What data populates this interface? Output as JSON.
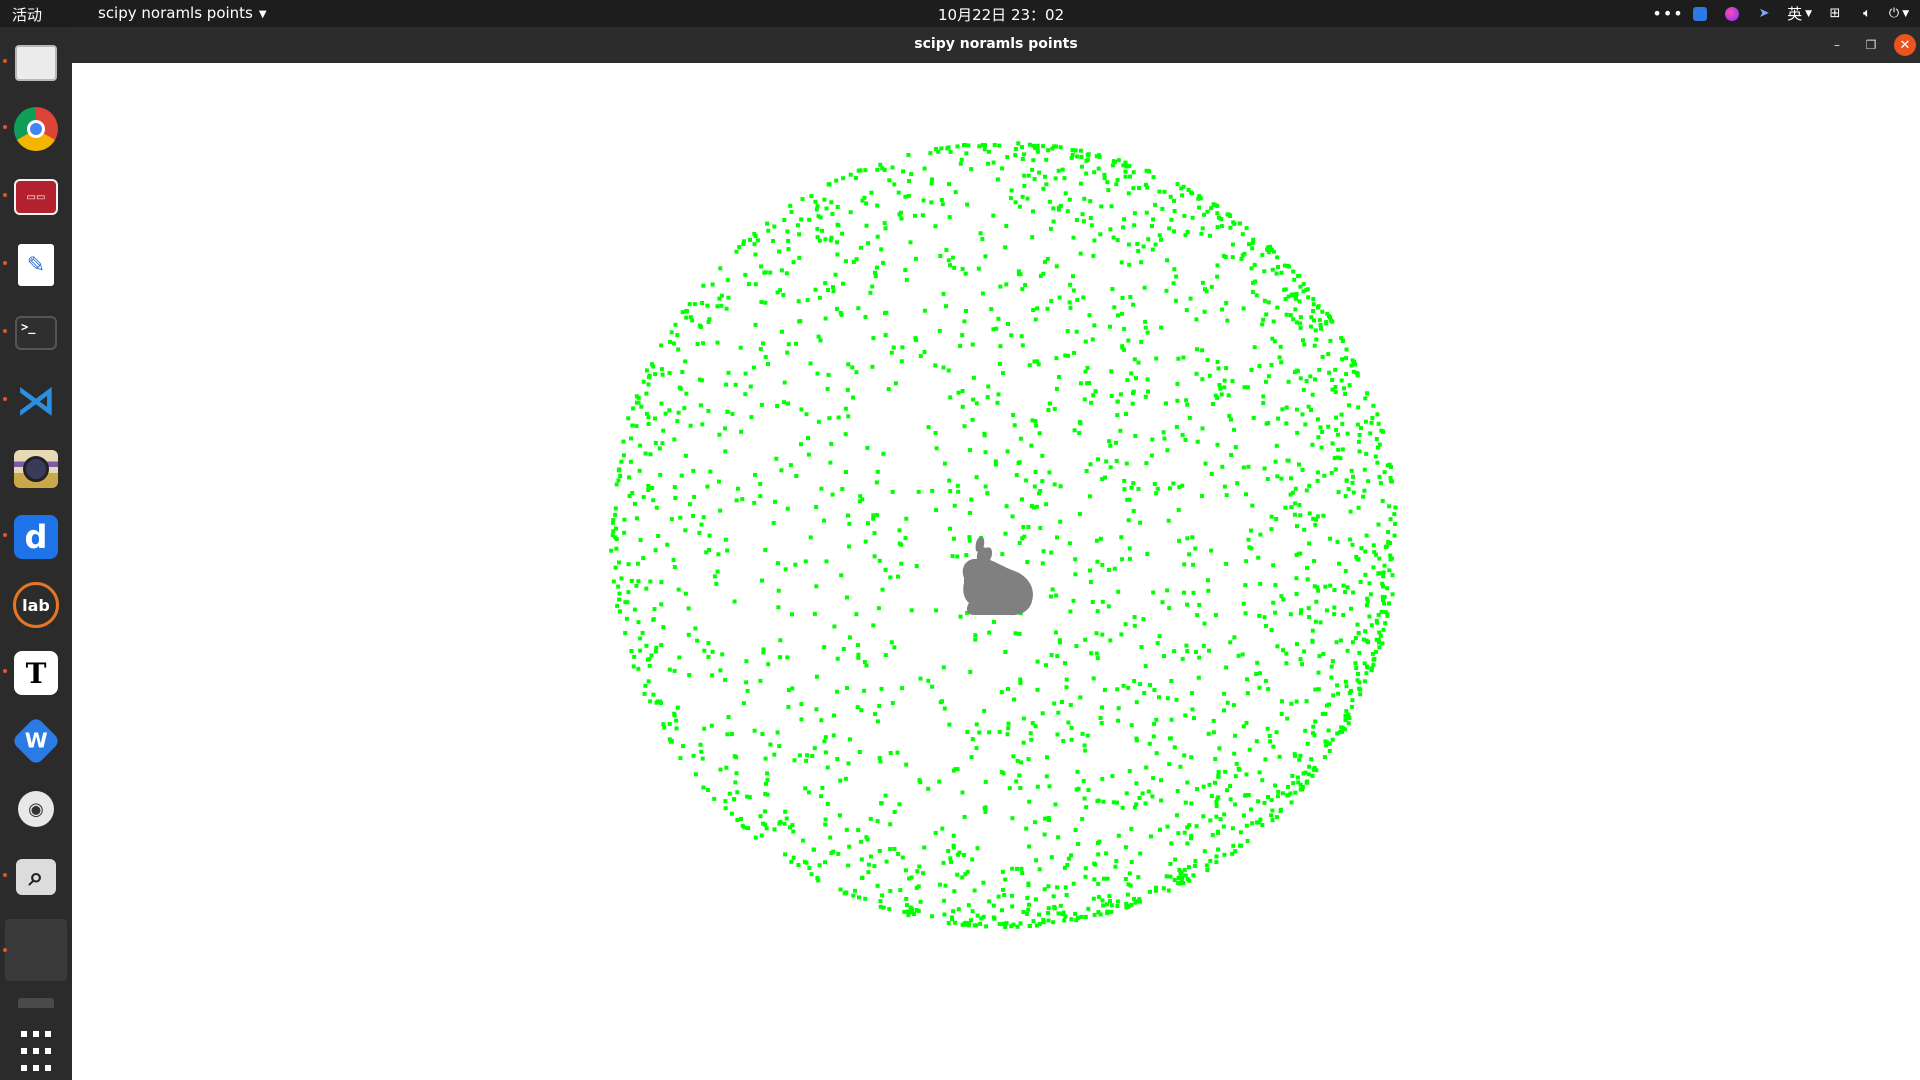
{
  "topbar": {
    "activities": "活动",
    "app_menu": "scipy noramls points",
    "clock": "10月22日  23：02",
    "input_method": "英"
  },
  "window": {
    "title": "scipy noramls points"
  },
  "colors": {
    "point_color": "#00ff00",
    "model_color": "#808080",
    "accent": "#e95420",
    "background": "#ffffff"
  },
  "dock": {
    "apps": [
      "files-icon",
      "chrome-icon",
      "remote-viewer-icon",
      "text-editor-icon",
      "terminal-icon",
      "vscode-icon",
      "camera-icon",
      "d-app-icon",
      "jupyterlab-icon",
      "typora-icon",
      "wps-icon",
      "eye-app-icon",
      "image-viewer-icon",
      "blank-window-icon",
      "small-app-icon",
      "show-apps-icon"
    ]
  },
  "scene": {
    "description_free": true,
    "model": "bunny"
  }
}
